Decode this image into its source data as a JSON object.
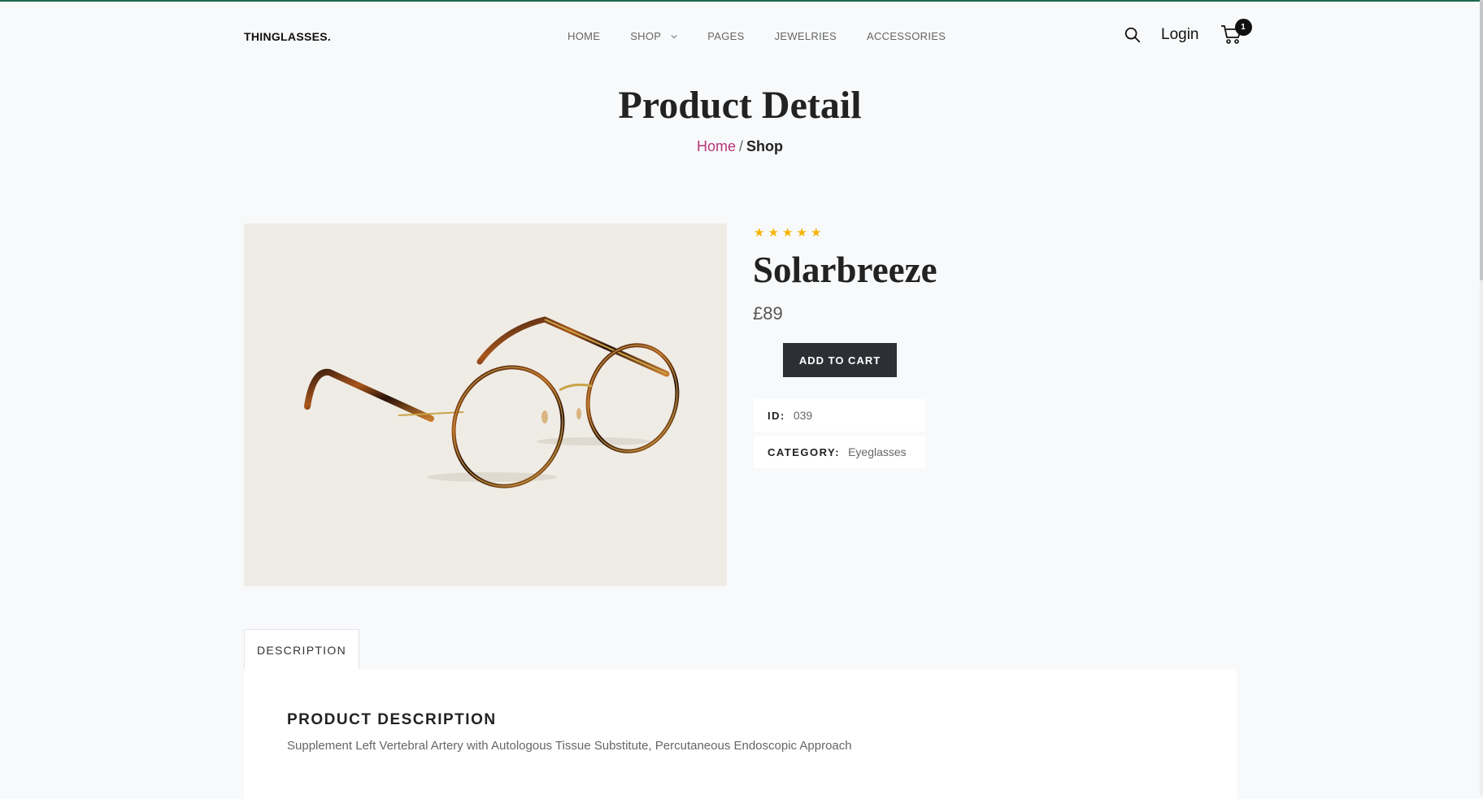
{
  "header": {
    "logo": "THINGLASSES.",
    "nav": [
      {
        "label": "HOME"
      },
      {
        "label": "SHOP"
      },
      {
        "label": "PAGES"
      },
      {
        "label": "JEWELRIES"
      },
      {
        "label": "ACCESSORIES"
      }
    ],
    "login_label": "Login",
    "cart_count": "1"
  },
  "page": {
    "title": "Product Detail",
    "breadcrumb": {
      "home": "Home",
      "separator": "/",
      "current": "Shop"
    }
  },
  "product": {
    "rating": 5,
    "rating_max": 5,
    "name": "Solarbreeze",
    "price": "£89",
    "add_to_cart_label": "ADD TO CART",
    "id_label": "ID:",
    "id_value": "039",
    "category_label": "CATEGORY:",
    "category_value": "Eyeglasses"
  },
  "tabs": {
    "description_tab": "DESCRIPTION",
    "description_title": "PRODUCT DESCRIPTION",
    "description_text": "Supplement Left Vertebral Artery with Autologous Tissue Substitute, Percutaneous Endoscopic Approach"
  },
  "colors": {
    "accent_top_line": "#1b6a4f",
    "breadcrumb_link": "#b5377a",
    "star": "#f5b400",
    "button_bg": "#2c3035"
  }
}
